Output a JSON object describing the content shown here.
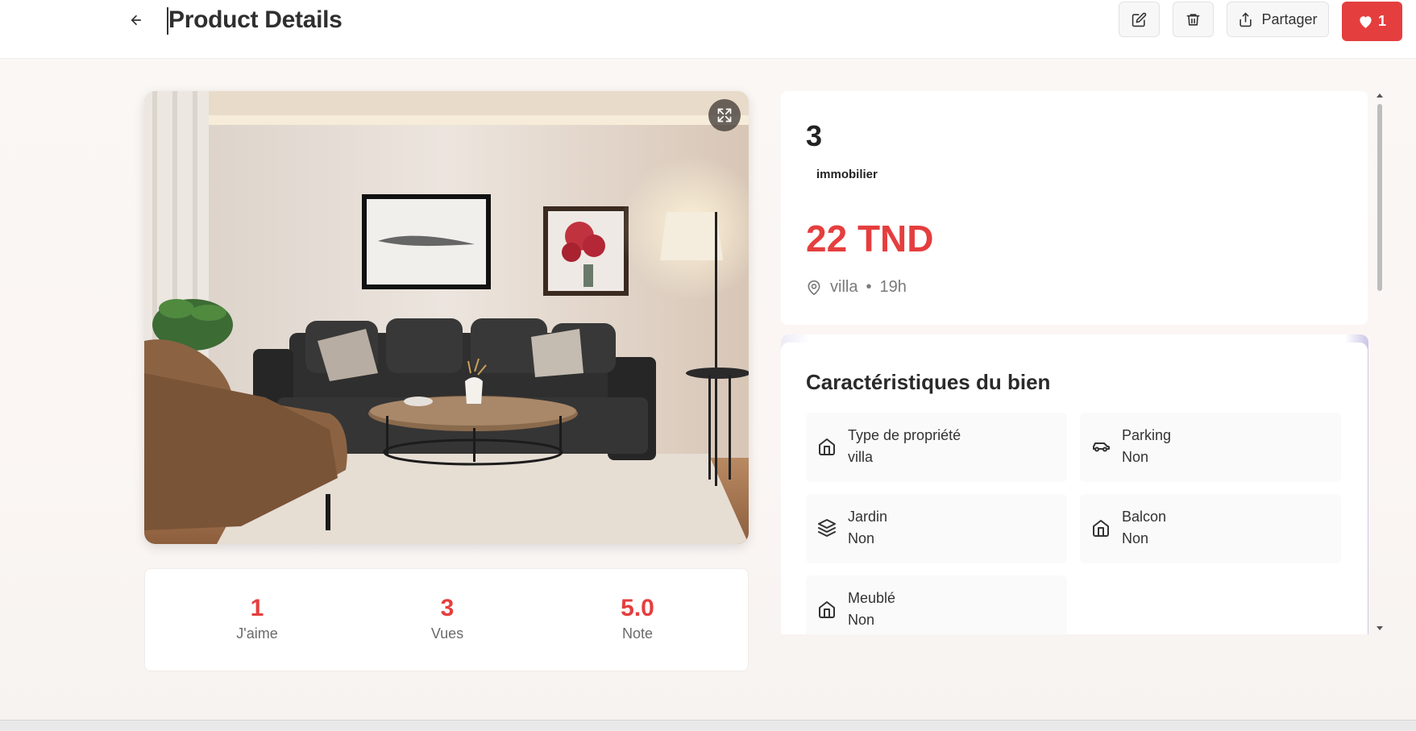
{
  "header": {
    "title": "Product Details",
    "share_label": "Partager",
    "like_count": "1"
  },
  "stats": [
    {
      "value": "1",
      "label": "J'aime"
    },
    {
      "value": "3",
      "label": "Vues"
    },
    {
      "value": "5.0",
      "label": "Note"
    }
  ],
  "product": {
    "title": "3",
    "category": "immobilier",
    "price": "22 TND",
    "location": "villa",
    "separator": "•",
    "time_ago": "19h"
  },
  "features": {
    "title": "Caractéristiques du bien",
    "items": [
      {
        "label": "Type de propriété",
        "value": "villa",
        "icon": "home-icon"
      },
      {
        "label": "Parking",
        "value": "Non",
        "icon": "car-icon"
      },
      {
        "label": "Jardin",
        "value": "Non",
        "icon": "layers-icon"
      },
      {
        "label": "Balcon",
        "value": "Non",
        "icon": "home-icon"
      },
      {
        "label": "Meublé",
        "value": "Non",
        "icon": "home-icon"
      }
    ]
  },
  "colors": {
    "accent": "#e53e3e",
    "text": "#1f2937",
    "muted": "#7a7a7a"
  }
}
